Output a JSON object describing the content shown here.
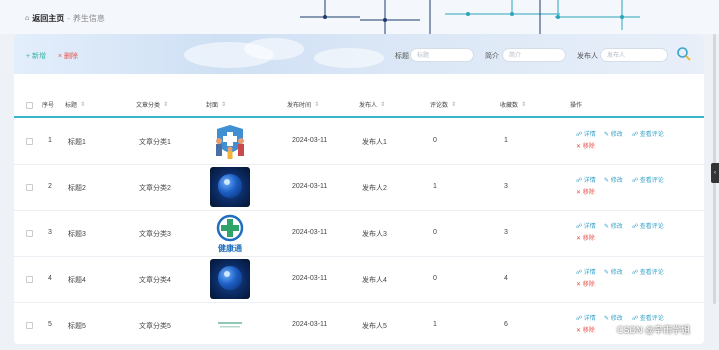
{
  "breadcrumb": {
    "home": "返回主页",
    "separator": "-",
    "current": "养生信息"
  },
  "toolbar": {
    "add_label": "+ 新增",
    "delete_label": "× 删除"
  },
  "filters": [
    {
      "label": "标题",
      "placeholder": "标题"
    },
    {
      "label": "简介",
      "placeholder": "简介"
    },
    {
      "label": "发布人",
      "placeholder": "发布人"
    }
  ],
  "table": {
    "columns": [
      "序号",
      "标题",
      "文章分类",
      "封面",
      "发布时间",
      "发布人",
      "评论数",
      "收藏数",
      "操作"
    ],
    "rows": [
      {
        "index": "1",
        "title": "标题1",
        "category": "文章分类1",
        "cover": "family-illustration",
        "date": "2024-03-11",
        "publisher": "发布人1",
        "comments": "0",
        "favorites": "1"
      },
      {
        "index": "2",
        "title": "标题2",
        "category": "文章分类2",
        "cover": "blue-sphere",
        "date": "2024-03-11",
        "publisher": "发布人2",
        "comments": "1",
        "favorites": "3"
      },
      {
        "index": "3",
        "title": "标题3",
        "category": "文章分类3",
        "cover": "health-logo",
        "cover_text": "健康通",
        "date": "2024-03-11",
        "publisher": "发布人3",
        "comments": "0",
        "favorites": "3"
      },
      {
        "index": "4",
        "title": "标题4",
        "category": "文章分类4",
        "cover": "blue-sphere",
        "date": "2024-03-11",
        "publisher": "发布人4",
        "comments": "0",
        "favorites": "4"
      },
      {
        "index": "5",
        "title": "标题5",
        "category": "文章分类5",
        "cover": "small-text-banner",
        "date": "2024-03-11",
        "publisher": "发布人5",
        "comments": "1",
        "favorites": "6"
      }
    ],
    "actions": {
      "detail": "详情",
      "edit": "修改",
      "view_comments": "查看评论",
      "remove": "移除"
    }
  },
  "watermark": "CSDN @辛雨学姐",
  "colors": {
    "accent": "#37b6c8",
    "danger": "#e8524a",
    "link": "#3aa3c9"
  }
}
